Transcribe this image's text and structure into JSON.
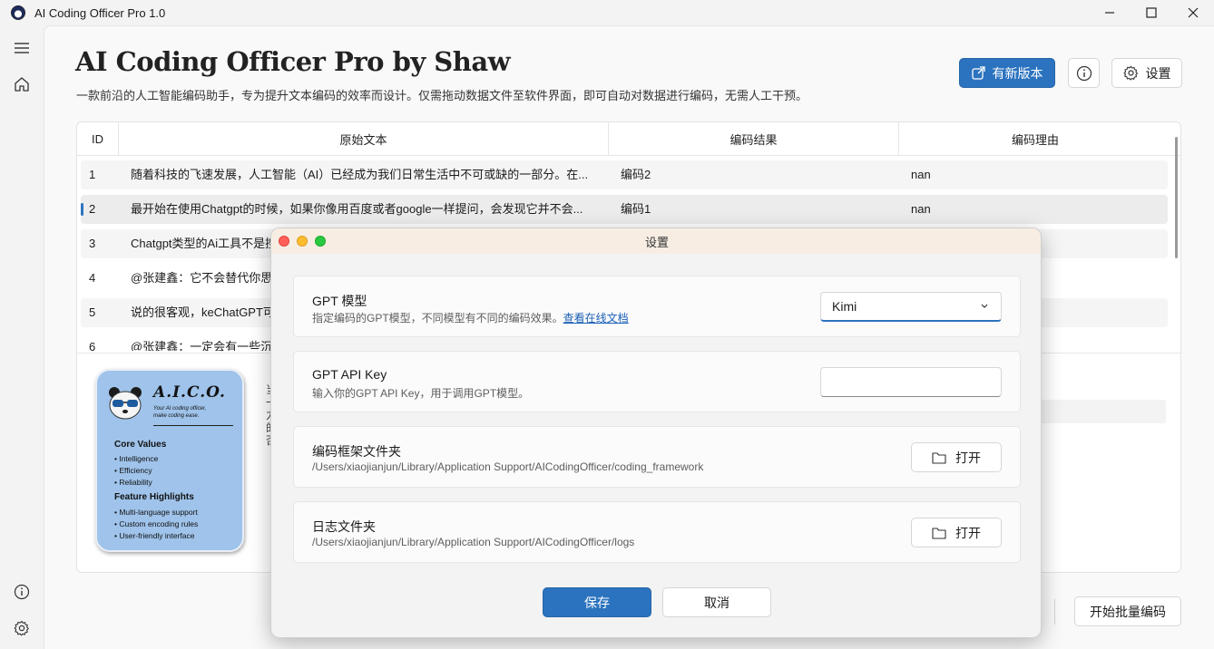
{
  "window": {
    "title": "AI Coding Officer Pro 1.0",
    "minimize_glyph": "—",
    "maximize_glyph": "☐",
    "close_glyph": "✕"
  },
  "sidebar": {
    "icons": [
      "menu-icon",
      "home-icon",
      "info-icon",
      "gear-icon"
    ]
  },
  "header": {
    "title": "AI Coding Officer Pro by Shaw",
    "description": "一款前沿的人工智能编码助手，专为提升文本编码的效率而设计。仅需拖动数据文件至软件界面，即可自动对数据进行编码，无需人工干预。",
    "update_label": "有新版本",
    "settings_label": "设置"
  },
  "table": {
    "columns": [
      "ID",
      "原始文本",
      "编码结果",
      "编码理由"
    ],
    "rows": [
      {
        "id": "1",
        "text": "随着科技的飞速发展，人工智能（AI）已经成为我们日常生活中不可或缺的一部分。在...",
        "result": "编码2",
        "reason": "nan"
      },
      {
        "id": "2",
        "text": "最开始在使用Chatgpt的时候，如果你像用百度或者google一样提问，会发现它并不会...",
        "result": "编码1",
        "reason": "nan"
      },
      {
        "id": "3",
        "text": "Chatgpt类型的Ai工具不是搜",
        "result": "",
        "reason": ""
      },
      {
        "id": "4",
        "text": "@张建鑫：它不会替代你思",
        "result": "",
        "reason": ""
      },
      {
        "id": "5",
        "text": "说的很客观，keChatGPT可",
        "result": "",
        "reason": ""
      },
      {
        "id": "6",
        "text": "@张建鑫：一定会有一些沉",
        "result": "",
        "reason": ""
      }
    ]
  },
  "info_panel": {
    "lines": [
      "当",
      "一",
      "力",
      "的",
      "否"
    ]
  },
  "poster": {
    "logo": "A.I.C.O.",
    "tagline_1": "Your AI coding officer,",
    "tagline_2": "make coding ease.",
    "core_values_title": "Core Values",
    "core_values": [
      "Intelligence",
      "Efficiency",
      "Reliability"
    ],
    "features_title": "Feature Highlights",
    "features": [
      "Multi-language support",
      "Custom encoding rules",
      "User-friendly interface"
    ]
  },
  "footer": {
    "batch_label": "开始批量编码"
  },
  "dialog": {
    "title": "设置",
    "model": {
      "title": "GPT 模型",
      "desc": "指定编码的GPT模型，不同模型有不同的编码效果。",
      "link": "查看在线文档",
      "value": "Kimi"
    },
    "api_key": {
      "title": "GPT API Key",
      "desc": "输入你的GPT API Key，用于调用GPT模型。",
      "value": ""
    },
    "framework": {
      "title": "编码框架文件夹",
      "path": "/Users/xiaojianjun/Library/Application Support/AICodingOfficer/coding_framework",
      "open_label": "打开"
    },
    "logs": {
      "title": "日志文件夹",
      "path": "/Users/xiaojianjun/Library/Application Support/AICodingOfficer/logs",
      "open_label": "打开"
    },
    "save_label": "保存",
    "cancel_label": "取消"
  },
  "colors": {
    "accent": "#2c73bf",
    "traffic_red": "#fe5f57",
    "traffic_yellow": "#febc2e",
    "traffic_green": "#28c840",
    "poster_bg": "#9fc3ea"
  }
}
